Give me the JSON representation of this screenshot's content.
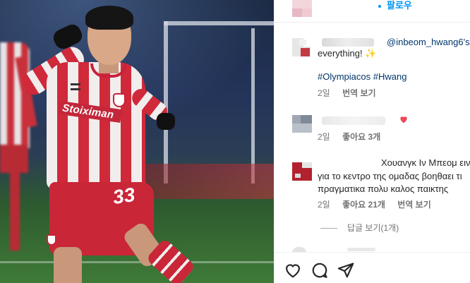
{
  "header": {
    "follow_label": "팔로우"
  },
  "caption": {
    "mention": "@inbeom_hwang6's",
    "line2": "everything! ✨",
    "hashtags": "#Olympiacos #Hwang",
    "time": "2일",
    "translate": "번역 보기"
  },
  "comments": [
    {
      "time": "2일",
      "likes": "좋아요 3개"
    },
    {
      "line1": "Χουανγκ Ιν Μπεομ ειν",
      "line2": "για το κεντρο της ομαδας βοηθαει τι",
      "line3": "πραγματικα πολυ καλος παικτης",
      "time": "2일",
      "likes": "좋아요 21개",
      "translate": "번역 보기",
      "replies_label": "답글 보기(1개)"
    }
  ],
  "photo": {
    "sponsor_text": "Stoiximan",
    "shorts_number": "33"
  },
  "actions": [
    "heart-icon",
    "comment-icon",
    "share-icon"
  ],
  "colors": {
    "link_blue": "#0095f6",
    "tag_blue": "#00376b",
    "heart_red": "#ed4956",
    "kit_red": "#d0293a"
  }
}
